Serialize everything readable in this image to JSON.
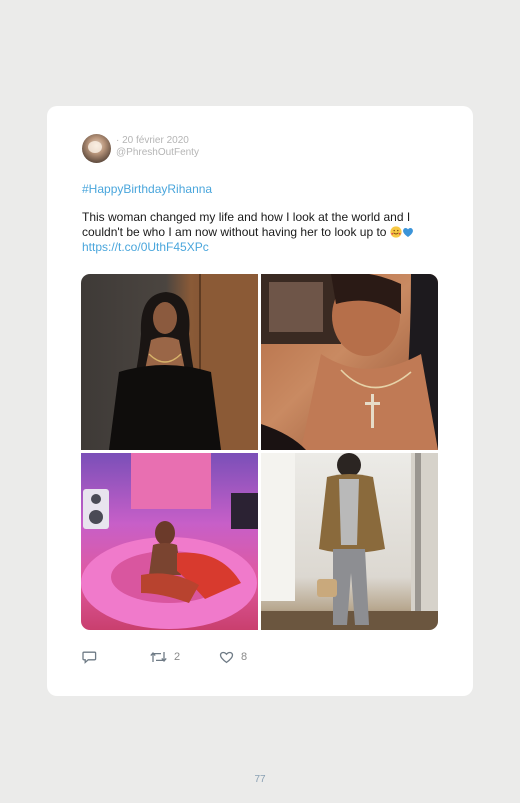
{
  "tweet": {
    "date": "· 20 février 2020",
    "handle": "@PhreshOutFenty",
    "hashtag": "#HappyBirthdayRihanna",
    "text": "This woman changed my life and how I look at the world and I couldn't be who I am now without having her to look up to",
    "link": "https://t.co/0UthF45XPc",
    "emojis": [
      "smiling-face-with-hearts",
      "blue-heart"
    ],
    "replies": "",
    "retweets": "2",
    "likes": "8"
  },
  "photos": [
    {
      "icon": "portrait-black-dress-photo"
    },
    {
      "icon": "closeup-necklace-photo"
    },
    {
      "icon": "pink-inflatable-photo"
    },
    {
      "icon": "jacket-mirror-photo"
    }
  ],
  "colors": {
    "background": "#ebebea",
    "card": "#ffffff",
    "link": "#4aa6dc",
    "meta": "#b5b5b5",
    "page_number": "#8aa0b3"
  },
  "page": {
    "number": "77"
  }
}
